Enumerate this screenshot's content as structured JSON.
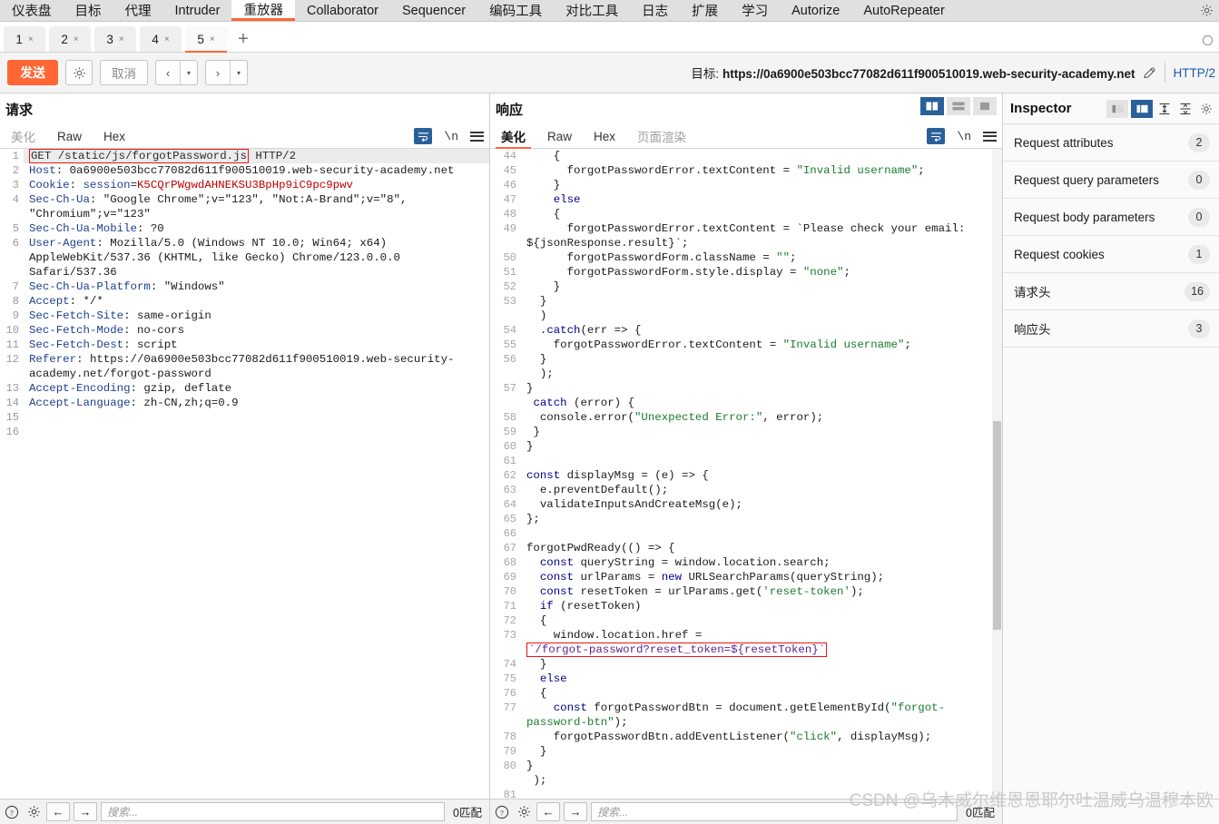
{
  "menu": {
    "tabs": [
      {
        "label": "仪表盘",
        "active": false
      },
      {
        "label": "目标",
        "active": false
      },
      {
        "label": "代理",
        "active": false
      },
      {
        "label": "Intruder",
        "active": false
      },
      {
        "label": "重放器",
        "active": true
      },
      {
        "label": "Collaborator",
        "active": false
      },
      {
        "label": "Sequencer",
        "active": false
      },
      {
        "label": "编码工具",
        "active": false
      },
      {
        "label": "对比工具",
        "active": false
      },
      {
        "label": "日志",
        "active": false
      },
      {
        "label": "扩展",
        "active": false
      },
      {
        "label": "学习",
        "active": false
      },
      {
        "label": "Autorize",
        "active": false
      },
      {
        "label": "AutoRepeater",
        "active": false
      }
    ],
    "settings_icon": "gear-icon"
  },
  "repeater_tabs": {
    "items": [
      {
        "label": "1",
        "close": "×",
        "active": false
      },
      {
        "label": "2",
        "close": "×",
        "active": false
      },
      {
        "label": "3",
        "close": "×",
        "active": false
      },
      {
        "label": "4",
        "close": "×",
        "active": false
      },
      {
        "label": "5",
        "close": "×",
        "active": true
      }
    ],
    "add_label": "+"
  },
  "actionbar": {
    "send_label": "发送",
    "settings_icon": "gear-icon",
    "cancel_label": "取消",
    "back_label": "‹",
    "forward_label": "›",
    "dropdown_caret": "▾",
    "target_prefix": "目标:",
    "target_url": "https://0a6900e503bcc77082d611f900510019.web-security-academy.net",
    "edit_icon": "pencil-icon",
    "protocol": "HTTP/2"
  },
  "request": {
    "title": "请求",
    "tabs": [
      {
        "label": "美化",
        "active": false,
        "dim": true
      },
      {
        "label": "Raw",
        "active": false,
        "dim": false
      },
      {
        "label": "Hex",
        "active": false,
        "dim": false
      }
    ],
    "icons": [
      "word-wrap-icon",
      "newline-icon",
      "menu-icon"
    ],
    "lines": [
      {
        "n": "1",
        "highlight": true,
        "boxed": true,
        "boxed_text": "GET /static/js/forgotPassword.js",
        "rest": " HTTP/2"
      },
      {
        "n": "2",
        "key": "Host",
        "sep": ": ",
        "value": "0a6900e503bcc77082d611f900510019.web-security-academy.net"
      },
      {
        "n": "3",
        "key": "Cookie",
        "sep": ": ",
        "value2": "session",
        "eq": "=",
        "value_red": "K5CQrPWgwdAHNEKSU3BpHp9iC9pc9pwv"
      },
      {
        "n": "4",
        "key": "Sec-Ch-Ua",
        "sep": ": ",
        "value": "\"Google Chrome\";v=\"123\", \"Not:A-Brand\";v=\"8\", \"Chromium\";v=\"123\""
      },
      {
        "n": "5",
        "key": "Sec-Ch-Ua-Mobile",
        "sep": ": ",
        "value": "?0"
      },
      {
        "n": "6",
        "key": "User-Agent",
        "sep": ": ",
        "value": "Mozilla/5.0 (Windows NT 10.0; Win64; x64) AppleWebKit/537.36 (KHTML, like Gecko) Chrome/123.0.0.0 Safari/537.36"
      },
      {
        "n": "7",
        "key": "Sec-Ch-Ua-Platform",
        "sep": ": ",
        "value": "\"Windows\""
      },
      {
        "n": "8",
        "key": "Accept",
        "sep": ": ",
        "value": "*/*"
      },
      {
        "n": "9",
        "key": "Sec-Fetch-Site",
        "sep": ": ",
        "value": "same-origin"
      },
      {
        "n": "10",
        "key": "Sec-Fetch-Mode",
        "sep": ": ",
        "value": "no-cors"
      },
      {
        "n": "11",
        "key": "Sec-Fetch-Dest",
        "sep": ": ",
        "value": "script"
      },
      {
        "n": "12",
        "key": "Referer",
        "sep": ": ",
        "value": "https://0a6900e503bcc77082d611f900510019.web-security-academy.net/forgot-password"
      },
      {
        "n": "13",
        "key": "Accept-Encoding",
        "sep": ": ",
        "value": "gzip, deflate"
      },
      {
        "n": "14",
        "key": "Accept-Language",
        "sep": ": ",
        "value": "zh-CN,zh;q=0.9"
      },
      {
        "n": "15",
        "value": ""
      },
      {
        "n": "16",
        "value": ""
      }
    ],
    "bottom": {
      "help_icon": "help-icon",
      "settings_icon": "gear-icon",
      "prev_label": "←",
      "next_label": "→",
      "search_placeholder": "搜索...",
      "match_count": "0匹配"
    }
  },
  "response": {
    "title": "响应",
    "tabs": [
      {
        "label": "美化",
        "active": true,
        "dim": false
      },
      {
        "label": "Raw",
        "active": false,
        "dim": false
      },
      {
        "label": "Hex",
        "active": false,
        "dim": false
      },
      {
        "label": "页面渲染",
        "active": false,
        "dim": true
      }
    ],
    "view_toggles": [
      "split-view-icon",
      "stacked-view-icon",
      "single-view-icon"
    ],
    "icons": [
      "word-wrap-icon",
      "newline-icon",
      "menu-icon"
    ],
    "highlighted_code_box": "`/forgot-password?reset_token=${resetToken}`",
    "code_lines": [
      {
        "n": "44",
        "segs": [
          {
            "t": "    {",
            "c": "k-plain"
          }
        ]
      },
      {
        "n": "45",
        "segs": [
          {
            "t": "      forgotPasswordError.textContent = ",
            "c": "k-plain"
          },
          {
            "t": "\"Invalid username\"",
            "c": "k-green"
          },
          {
            "t": ";",
            "c": "k-plain"
          }
        ]
      },
      {
        "n": "46",
        "segs": [
          {
            "t": "    }",
            "c": "k-plain"
          }
        ]
      },
      {
        "n": "47",
        "segs": [
          {
            "t": "    ",
            "c": "k-plain"
          },
          {
            "t": "else",
            "c": "k-dkblue"
          }
        ]
      },
      {
        "n": "48",
        "segs": [
          {
            "t": "    {",
            "c": "k-plain"
          }
        ]
      },
      {
        "n": "49",
        "segs": [
          {
            "t": "      forgotPasswordError.textContent = `Please check your email: ${jsonResponse.result}`;",
            "c": "k-plain"
          }
        ]
      },
      {
        "n": "50",
        "segs": [
          {
            "t": "      forgotPasswordForm.className = ",
            "c": "k-plain"
          },
          {
            "t": "\"\"",
            "c": "k-green"
          },
          {
            "t": ";",
            "c": "k-plain"
          }
        ]
      },
      {
        "n": "51",
        "segs": [
          {
            "t": "      forgotPasswordForm.style.display = ",
            "c": "k-plain"
          },
          {
            "t": "\"none\"",
            "c": "k-green"
          },
          {
            "t": ";",
            "c": "k-plain"
          }
        ]
      },
      {
        "n": "52",
        "segs": [
          {
            "t": "    }",
            "c": "k-plain"
          }
        ]
      },
      {
        "n": "53",
        "segs": [
          {
            "t": "  }",
            "c": "k-plain"
          }
        ]
      },
      {
        "n": "",
        "segs": [
          {
            "t": "  )",
            "c": "k-plain"
          }
        ]
      },
      {
        "n": "54",
        "segs": [
          {
            "t": "  .",
            "c": "k-plain"
          },
          {
            "t": "catch",
            "c": "k-dkblue"
          },
          {
            "t": "(err => {",
            "c": "k-plain"
          }
        ]
      },
      {
        "n": "55",
        "segs": [
          {
            "t": "    forgotPasswordError.textContent = ",
            "c": "k-plain"
          },
          {
            "t": "\"Invalid username\"",
            "c": "k-green"
          },
          {
            "t": ";",
            "c": "k-plain"
          }
        ]
      },
      {
        "n": "56",
        "segs": [
          {
            "t": "  }",
            "c": "k-plain"
          }
        ]
      },
      {
        "n": "",
        "segs": [
          {
            "t": "  );",
            "c": "k-plain"
          }
        ]
      },
      {
        "n": "57",
        "segs": [
          {
            "t": "}",
            "c": "k-plain"
          }
        ]
      },
      {
        "n": "",
        "segs": [
          {
            "t": " ",
            "c": "k-plain"
          },
          {
            "t": "catch",
            "c": "k-dkblue"
          },
          {
            "t": " (error) {",
            "c": "k-plain"
          }
        ]
      },
      {
        "n": "58",
        "segs": [
          {
            "t": "  console.error(",
            "c": "k-plain"
          },
          {
            "t": "\"Unexpected Error:\"",
            "c": "k-green"
          },
          {
            "t": ", error);",
            "c": "k-plain"
          }
        ]
      },
      {
        "n": "59",
        "segs": [
          {
            "t": " }",
            "c": "k-plain"
          }
        ]
      },
      {
        "n": "60",
        "segs": [
          {
            "t": "}",
            "c": "k-plain"
          }
        ]
      },
      {
        "n": "61",
        "segs": [
          {
            "t": "",
            "c": "k-plain"
          }
        ]
      },
      {
        "n": "62",
        "segs": [
          {
            "t": "const",
            "c": "k-dkblue"
          },
          {
            "t": " displayMsg = (e) => {",
            "c": "k-plain"
          }
        ]
      },
      {
        "n": "63",
        "segs": [
          {
            "t": "  e.preventDefault();",
            "c": "k-plain"
          }
        ]
      },
      {
        "n": "64",
        "segs": [
          {
            "t": "  validateInputsAndCreateMsg(e);",
            "c": "k-plain"
          }
        ]
      },
      {
        "n": "65",
        "segs": [
          {
            "t": "};",
            "c": "k-plain"
          }
        ]
      },
      {
        "n": "66",
        "segs": [
          {
            "t": "",
            "c": "k-plain"
          }
        ]
      },
      {
        "n": "67",
        "segs": [
          {
            "t": "forgotPwdReady(() => {",
            "c": "k-plain"
          }
        ]
      },
      {
        "n": "68",
        "segs": [
          {
            "t": "  ",
            "c": "k-plain"
          },
          {
            "t": "const",
            "c": "k-dkblue"
          },
          {
            "t": " queryString = window.location.search;",
            "c": "k-plain"
          }
        ]
      },
      {
        "n": "69",
        "segs": [
          {
            "t": "  ",
            "c": "k-plain"
          },
          {
            "t": "const",
            "c": "k-dkblue"
          },
          {
            "t": " urlParams = ",
            "c": "k-plain"
          },
          {
            "t": "new",
            "c": "k-dkblue"
          },
          {
            "t": " URLSearchParams(queryString);",
            "c": "k-plain"
          }
        ]
      },
      {
        "n": "70",
        "segs": [
          {
            "t": "  ",
            "c": "k-plain"
          },
          {
            "t": "const",
            "c": "k-dkblue"
          },
          {
            "t": " resetToken = urlParams.get(",
            "c": "k-plain"
          },
          {
            "t": "'reset-token'",
            "c": "k-green"
          },
          {
            "t": ");",
            "c": "k-plain"
          }
        ]
      },
      {
        "n": "71",
        "segs": [
          {
            "t": "  ",
            "c": "k-plain"
          },
          {
            "t": "if",
            "c": "k-dkblue"
          },
          {
            "t": " (resetToken)",
            "c": "k-plain"
          }
        ]
      },
      {
        "n": "72",
        "segs": [
          {
            "t": "  {",
            "c": "k-plain"
          }
        ]
      },
      {
        "n": "73",
        "segs": [
          {
            "t": "    window.location.href = ",
            "c": "k-plain"
          },
          {
            "t": "BOXED",
            "c": "k-purple"
          }
        ]
      },
      {
        "n": "74",
        "segs": [
          {
            "t": "  }",
            "c": "k-plain"
          }
        ]
      },
      {
        "n": "75",
        "segs": [
          {
            "t": "  ",
            "c": "k-plain"
          },
          {
            "t": "else",
            "c": "k-dkblue"
          }
        ]
      },
      {
        "n": "76",
        "segs": [
          {
            "t": "  {",
            "c": "k-plain"
          }
        ]
      },
      {
        "n": "77",
        "segs": [
          {
            "t": "    ",
            "c": "k-plain"
          },
          {
            "t": "const",
            "c": "k-dkblue"
          },
          {
            "t": " forgotPasswordBtn = document.getElementById(",
            "c": "k-plain"
          },
          {
            "t": "\"forgot-password-btn\"",
            "c": "k-green"
          },
          {
            "t": ");",
            "c": "k-plain"
          }
        ]
      },
      {
        "n": "78",
        "segs": [
          {
            "t": "    forgotPasswordBtn.addEventListener(",
            "c": "k-plain"
          },
          {
            "t": "\"click\"",
            "c": "k-green"
          },
          {
            "t": ", displayMsg);",
            "c": "k-plain"
          }
        ]
      },
      {
        "n": "79",
        "segs": [
          {
            "t": "  }",
            "c": "k-plain"
          }
        ]
      },
      {
        "n": "80",
        "segs": [
          {
            "t": "}",
            "c": "k-plain"
          }
        ]
      },
      {
        "n": "",
        "segs": [
          {
            "t": " );",
            "c": "k-plain"
          }
        ]
      },
      {
        "n": "81",
        "segs": [
          {
            "t": "",
            "c": "k-plain"
          }
        ]
      }
    ],
    "bottom": {
      "help_icon": "help-icon",
      "settings_icon": "gear-icon",
      "prev_label": "←",
      "next_label": "→",
      "search_placeholder": "搜索...",
      "match_count": "0匹配"
    }
  },
  "inspector": {
    "title": "Inspector",
    "toggles": [
      "layout-left-icon",
      "layout-right-icon",
      "expand-all-icon",
      "collapse-all-icon",
      "gear-icon"
    ],
    "rows": [
      {
        "label": "Request attributes",
        "count": "2"
      },
      {
        "label": "Request query parameters",
        "count": "0"
      },
      {
        "label": "Request body parameters",
        "count": "0"
      },
      {
        "label": "Request cookies",
        "count": "1"
      },
      {
        "label": "请求头",
        "count": "16"
      },
      {
        "label": "响应头",
        "count": "3"
      }
    ]
  },
  "watermark": "CSDN @乌木威尔维恩恩耶尔吐温威乌温穆本欧",
  "colors": {
    "accent_orange": "#ff6633",
    "accent_blue": "#2a6099",
    "highlight_red": "#ee1111",
    "string_green": "#1a7a2e",
    "keyword_blue": "#00008b",
    "header_blue": "#1d3f8f",
    "cookie_red": "#c00000"
  }
}
